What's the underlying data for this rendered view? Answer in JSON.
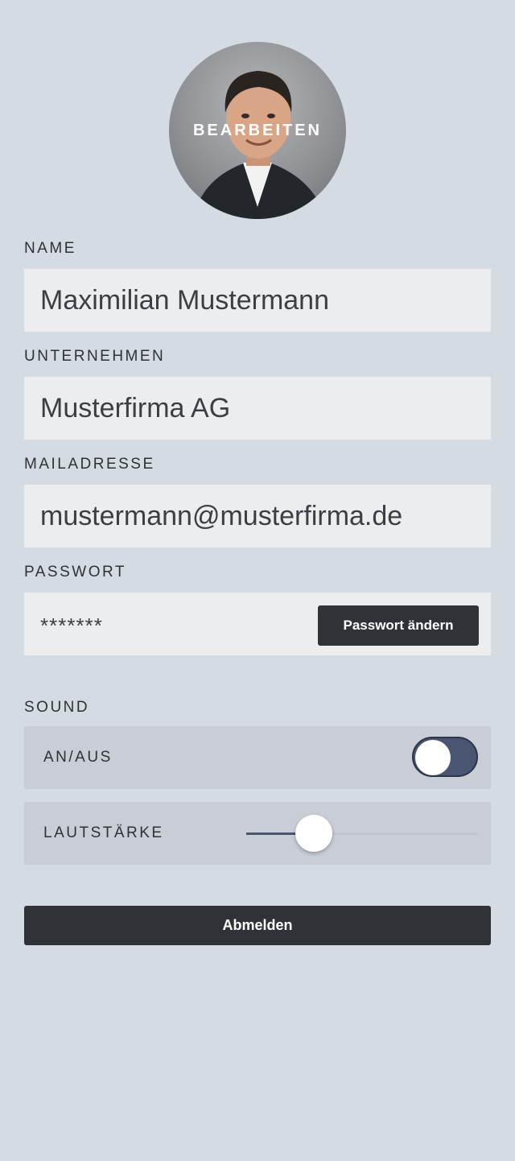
{
  "profile": {
    "avatar_action": "BEARBEITEN"
  },
  "fields": {
    "name": {
      "label": "NAME",
      "value": "Maximilian Mustermann"
    },
    "company": {
      "label": "UNTERNEHMEN",
      "value": "Musterfirma AG"
    },
    "email": {
      "label": "MAILADRESSE",
      "value": "mustermann@musterfirma.de"
    },
    "password": {
      "label": "PASSWORT",
      "value": "*******",
      "change_button": "Passwort ändern"
    }
  },
  "sound": {
    "section_label": "SOUND",
    "toggle_label": "AN/AUS",
    "toggle_on": true,
    "volume_label": "LAUTSTÄRKE",
    "volume_fraction": 0.29
  },
  "logout_button": "Abmelden",
  "colors": {
    "background": "#d5dbe3",
    "field_background": "#ecedef",
    "panel_background": "#c9cdd6",
    "dark_button": "#2f3338",
    "accent": "#4a5572"
  }
}
